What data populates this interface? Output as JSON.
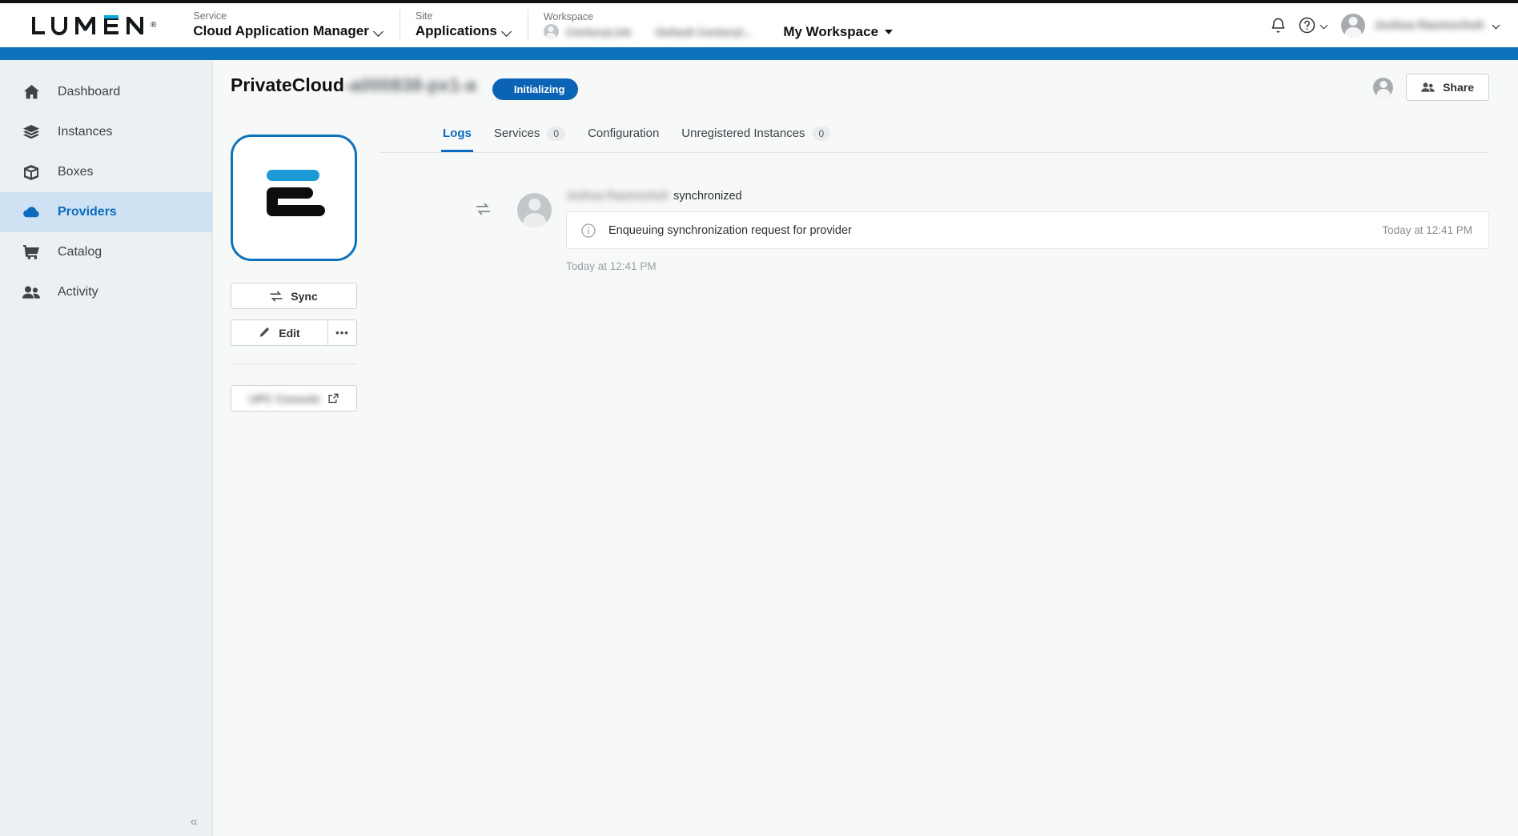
{
  "header": {
    "logo_text": "LUMEN",
    "logo_registered": "®",
    "service": {
      "label": "Service",
      "value": "Cloud Application Manager"
    },
    "site": {
      "label": "Site",
      "value": "Applications"
    },
    "workspace": {
      "label": "Workspace",
      "org_name": "CenturyLink",
      "sub_name": "Default Centuryl...",
      "selector": "My Workspace"
    },
    "icons": {
      "notifications": "bell-icon",
      "help": "help-circle-icon",
      "user_avatar": "avatar-icon"
    },
    "user_name": "Joshua Raumschuh",
    "accent_blue": "#0c73ba"
  },
  "sidebar": {
    "items": [
      {
        "label": "Dashboard",
        "icon": "home-icon",
        "active": false
      },
      {
        "label": "Instances",
        "icon": "layers-icon",
        "active": false
      },
      {
        "label": "Boxes",
        "icon": "cube-icon",
        "active": false
      },
      {
        "label": "Providers",
        "icon": "cloud-icon",
        "active": true
      },
      {
        "label": "Catalog",
        "icon": "shopping-cart-icon",
        "active": false
      },
      {
        "label": "Activity",
        "icon": "people-icon",
        "active": false
      }
    ],
    "collapse_label": "«",
    "active_color": "#0c6bc0"
  },
  "page": {
    "title": "PrivateCloud",
    "title_suffix": "-a000838-px1-a",
    "status_badge": "Initializing",
    "status_color": "#0a63b5",
    "share_button": "Share"
  },
  "provider_panel": {
    "logo_alt": "lumen-provider-logo",
    "sync_button": "Sync",
    "edit_button": "Edit",
    "more_button": "•••",
    "console_button": "UPC Console",
    "console_icon": "external-link-icon"
  },
  "tabs": [
    {
      "label": "Logs",
      "count": null,
      "active": true
    },
    {
      "label": "Services",
      "count": "0",
      "active": false
    },
    {
      "label": "Configuration",
      "count": null,
      "active": false
    },
    {
      "label": "Unregistered Instances",
      "count": "0",
      "active": false
    }
  ],
  "log": {
    "event_icon": "sync-icon",
    "actor": "Joshua Raumschuh",
    "action": "synchronized",
    "message": "Enqueuing synchronization request for provider",
    "message_icon": "info-circle-icon",
    "message_time": "Today at 12:41 PM",
    "footer_time": "Today at 12:41 PM"
  }
}
